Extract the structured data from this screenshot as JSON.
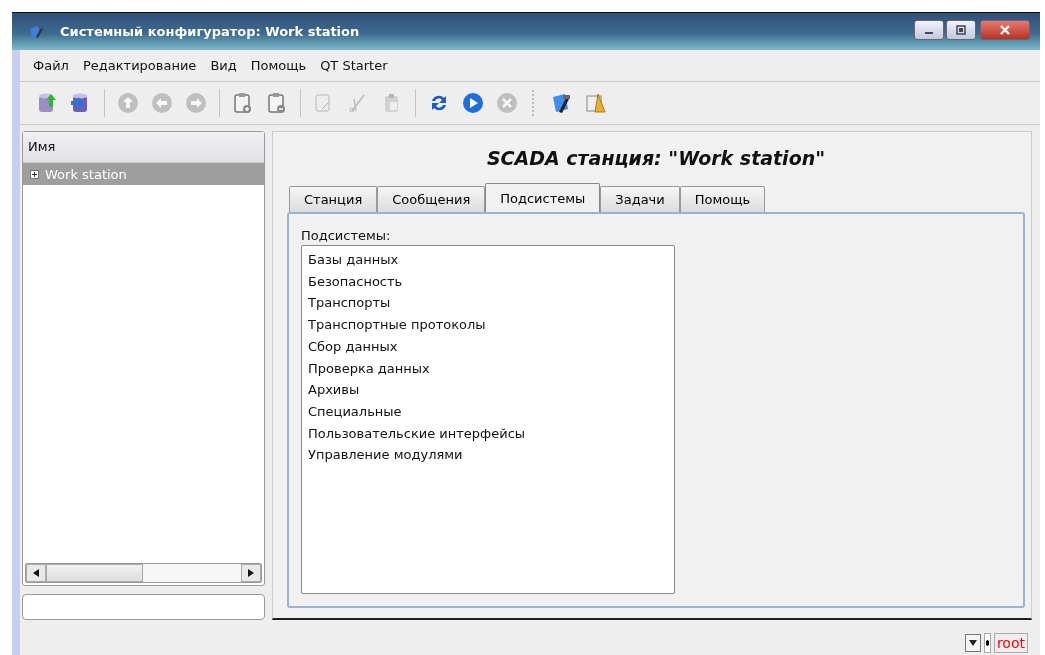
{
  "window": {
    "title": "Системный конфигуратор: Work station"
  },
  "menu": [
    {
      "label": "Файл"
    },
    {
      "label": "Редактирование"
    },
    {
      "label": "Вид"
    },
    {
      "label": "Помощь"
    },
    {
      "label": "QT Starter"
    }
  ],
  "toolbar": [
    {
      "kind": "db-up",
      "disabled": false
    },
    {
      "kind": "db-down",
      "disabled": false
    },
    {
      "kind": "sep"
    },
    {
      "kind": "up",
      "disabled": true
    },
    {
      "kind": "left",
      "disabled": true
    },
    {
      "kind": "right",
      "disabled": true
    },
    {
      "kind": "sep"
    },
    {
      "kind": "clip-add",
      "disabled": false
    },
    {
      "kind": "clip-remove",
      "disabled": false
    },
    {
      "kind": "sep"
    },
    {
      "kind": "copy",
      "disabled": true
    },
    {
      "kind": "cut",
      "disabled": true
    },
    {
      "kind": "paste",
      "disabled": true
    },
    {
      "kind": "sep"
    },
    {
      "kind": "refresh",
      "disabled": false
    },
    {
      "kind": "play",
      "disabled": false
    },
    {
      "kind": "stop",
      "disabled": true
    },
    {
      "kind": "grip"
    },
    {
      "kind": "tools",
      "disabled": false
    },
    {
      "kind": "draw",
      "disabled": false
    }
  ],
  "tree": {
    "header": "Имя",
    "items": [
      {
        "label": "Work station",
        "selected": true,
        "expanded": false
      }
    ]
  },
  "page_title": "SCADA станция: \"Work station\"",
  "tabs": [
    {
      "label": "Станция",
      "selected": false
    },
    {
      "label": "Сообщения",
      "selected": false
    },
    {
      "label": "Подсистемы",
      "selected": true
    },
    {
      "label": "Задачи",
      "selected": false
    },
    {
      "label": "Помощь",
      "selected": false
    }
  ],
  "subsystems": {
    "label": "Подсистемы:",
    "items": [
      "Базы данных",
      "Безопасность",
      "Транспорты",
      "Транспортные протоколы",
      "Сбор данных",
      "Проверка данных",
      "Архивы",
      "Специальные",
      "Пользовательские интерфейсы",
      "Управление модулями"
    ]
  },
  "status_bar": {
    "user": "root"
  }
}
